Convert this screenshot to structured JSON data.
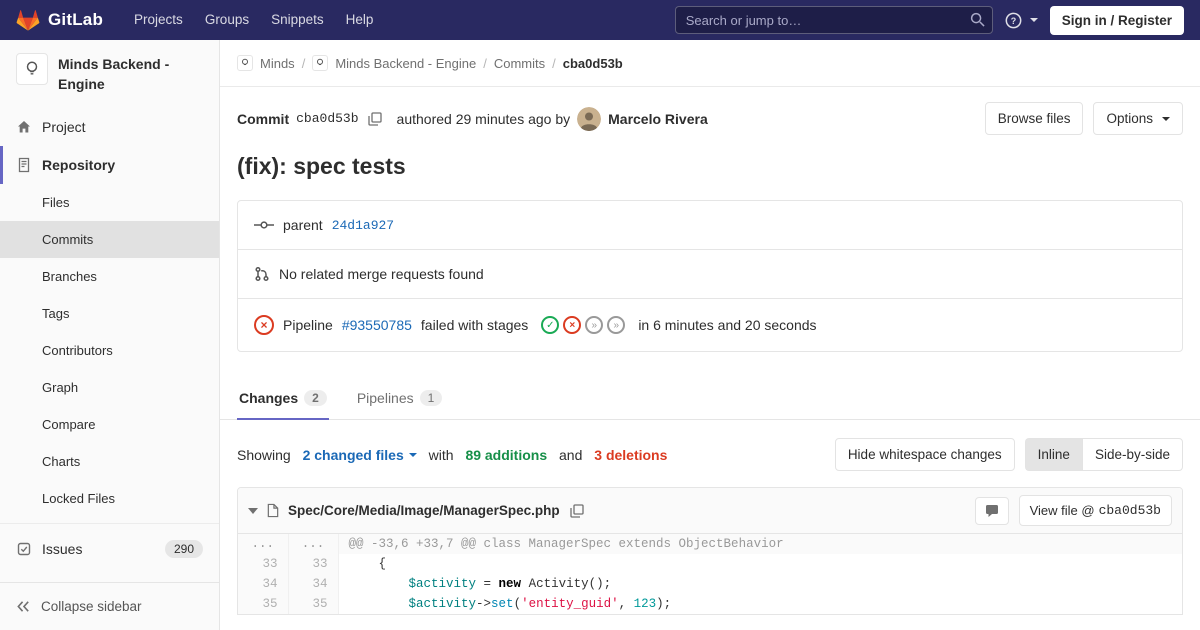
{
  "navbar": {
    "brand": "GitLab",
    "menu": [
      "Projects",
      "Groups",
      "Snippets",
      "Help"
    ],
    "search_placeholder": "Search or jump to…",
    "sign_in_label": "Sign in / Register"
  },
  "sidebar": {
    "project_title": "Minds Backend - Engine",
    "project_item": "Project",
    "repository_item": "Repository",
    "repository_sub": [
      "Files",
      "Commits",
      "Branches",
      "Tags",
      "Contributors",
      "Graph",
      "Compare",
      "Charts",
      "Locked Files"
    ],
    "active_sub": "Commits",
    "issues_item": "Issues",
    "issues_count": "290",
    "collapse_label": "Collapse sidebar"
  },
  "breadcrumb": {
    "items": [
      "Minds",
      "Minds Backend - Engine",
      "Commits",
      "cba0d53b"
    ]
  },
  "commit": {
    "label": "Commit",
    "sha": "cba0d53b",
    "authored_text": "authored 29 minutes ago by",
    "author": "Marcelo Rivera",
    "browse_files_label": "Browse files",
    "options_label": "Options",
    "title": "(fix): spec tests"
  },
  "info": {
    "parent_label": "parent",
    "parent_sha": "24d1a927",
    "no_mr_text": "No related merge requests found",
    "pipeline_label": "Pipeline",
    "pipeline_id": "#93550785",
    "pipeline_status_text": "failed with stages",
    "pipeline_stages": [
      "success",
      "failed",
      "skipped",
      "skipped"
    ],
    "pipeline_duration": "in 6 minutes and 20 seconds"
  },
  "tabs": {
    "changes_label": "Changes",
    "changes_count": "2",
    "pipelines_label": "Pipelines",
    "pipelines_count": "1"
  },
  "summary": {
    "showing": "Showing",
    "changed_files": "2 changed files",
    "with": "with",
    "additions": "89 additions",
    "and": "and",
    "deletions": "3 deletions",
    "hide_whitespace_label": "Hide whitespace changes",
    "inline_label": "Inline",
    "side_by_side_label": "Side-by-side"
  },
  "diff": {
    "file_path": "Spec/Core/Media/Image/ManagerSpec.php",
    "view_file_label": "View file @",
    "view_file_sha": "cba0d53b",
    "hunk_ln": "...",
    "hunk_header": "@@ -33,6 +33,7 @@ class ManagerSpec extends ObjectBehavior",
    "lines": [
      {
        "old": "33",
        "new": "33",
        "tokens": [
          {
            "t": "    {",
            "c": "p"
          }
        ]
      },
      {
        "old": "34",
        "new": "34",
        "tokens": [
          {
            "t": "        ",
            "c": "p"
          },
          {
            "t": "$activity",
            "c": "nv"
          },
          {
            "t": " = ",
            "c": "p"
          },
          {
            "t": "new",
            "c": "k"
          },
          {
            "t": " Activity();",
            "c": "p"
          }
        ]
      },
      {
        "old": "35",
        "new": "35",
        "tokens": [
          {
            "t": "        ",
            "c": "p"
          },
          {
            "t": "$activity",
            "c": "nv"
          },
          {
            "t": "->",
            "c": "p"
          },
          {
            "t": "set",
            "c": "nb"
          },
          {
            "t": "(",
            "c": "p"
          },
          {
            "t": "'entity_guid'",
            "c": "s"
          },
          {
            "t": ", ",
            "c": "p"
          },
          {
            "t": "123",
            "c": "m"
          },
          {
            "t": ");",
            "c": "p"
          }
        ]
      }
    ]
  },
  "colors": {
    "navbar_bg": "#292961",
    "accent_purple": "#6666c4",
    "link_blue": "#1b69b6",
    "addition_green": "#168f48",
    "deletion_red": "#db3b21",
    "success_green": "#1aaa55",
    "skipped_gray": "#999999"
  }
}
